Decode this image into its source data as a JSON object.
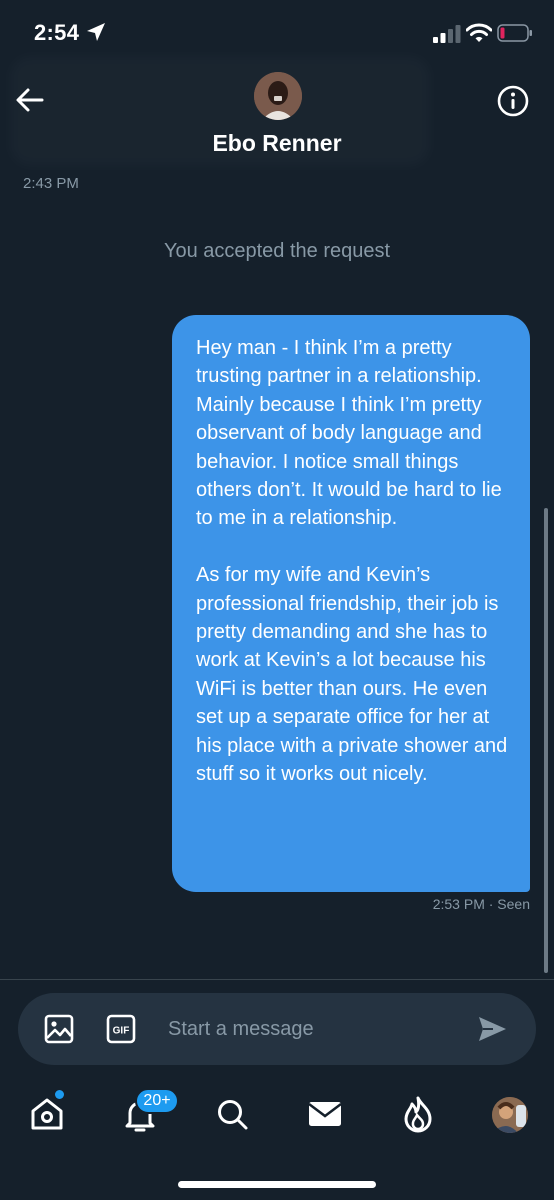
{
  "status_bar": {
    "time": "2:54",
    "icons": [
      "location-arrow-icon",
      "cellular-signal-icon",
      "wifi-icon",
      "battery-low-icon"
    ],
    "battery_color": "#e0245e"
  },
  "header": {
    "contact_name": "Ebo Renner",
    "icons": [
      "back-arrow-icon",
      "info-icon"
    ]
  },
  "conversation": {
    "timestamp": "2:43 PM",
    "system_message": "You accepted the request",
    "message": {
      "paragraphs": [
        "Hey man - I think I’m a pretty trusting partner in a relationship. Mainly because I think I’m pretty observant of body language and behavior. I notice small things others don’t. It would be hard to lie to me in a relationship.",
        "As for my wife and Kevin’s professional friendship, their job is pretty demanding and she has to work at Kevin’s a lot because his WiFi is better than ours. He even set up a separate office for her at his place with a private shower and stuff so it works out nicely."
      ],
      "time": "2:53 PM",
      "status": "· Seen",
      "bubble_color": "#3d94e8"
    }
  },
  "composer": {
    "placeholder": "Start a message",
    "gif_label": "GIF",
    "icons": [
      "image-icon",
      "gif-icon",
      "send-icon"
    ]
  },
  "tab_bar": {
    "notifications_badge": "20+",
    "icons": [
      "home-icon",
      "notifications-bell-icon",
      "search-icon",
      "messages-mail-icon",
      "spaces-flame-icon",
      "profile-avatar"
    ],
    "accent_color": "#1d9bf0"
  },
  "colors": {
    "background": "#15202b",
    "muted_text": "#8899a6",
    "composer_background": "#253341"
  }
}
